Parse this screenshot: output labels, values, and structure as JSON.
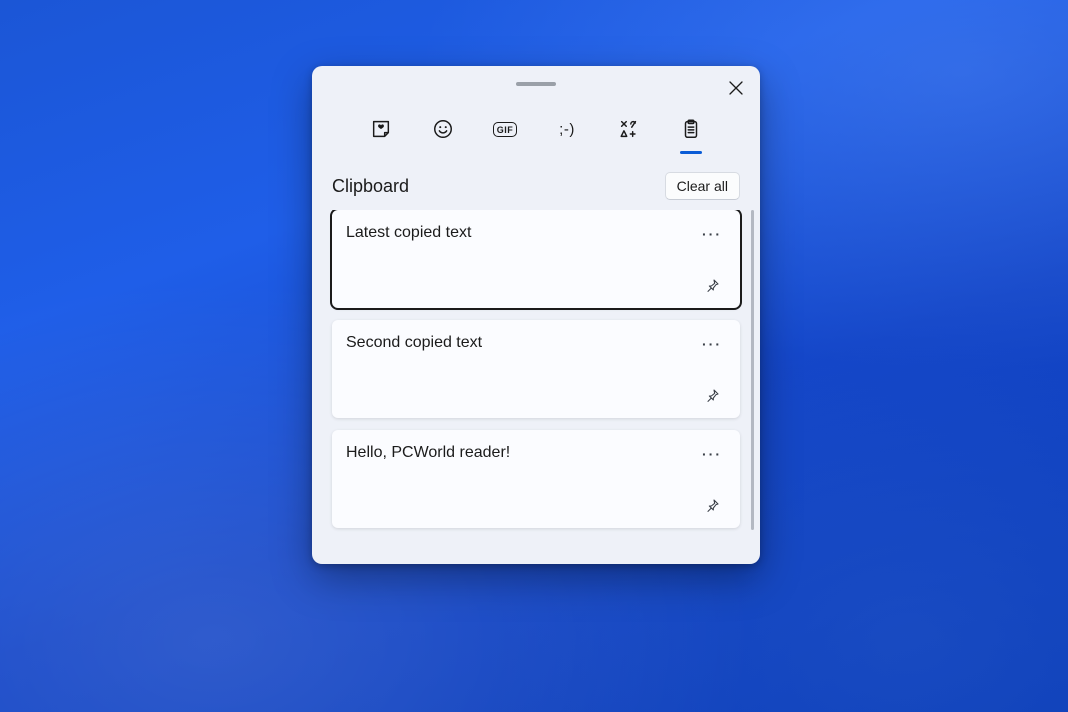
{
  "section": {
    "title": "Clipboard",
    "clear_label": "Clear all"
  },
  "tabs": {
    "gif_label": "GIF",
    "kaomoji_label": ";-)"
  },
  "items": [
    {
      "text": "Latest copied text"
    },
    {
      "text": "Second copied text"
    },
    {
      "text": "Hello, PCWorld reader!"
    }
  ]
}
